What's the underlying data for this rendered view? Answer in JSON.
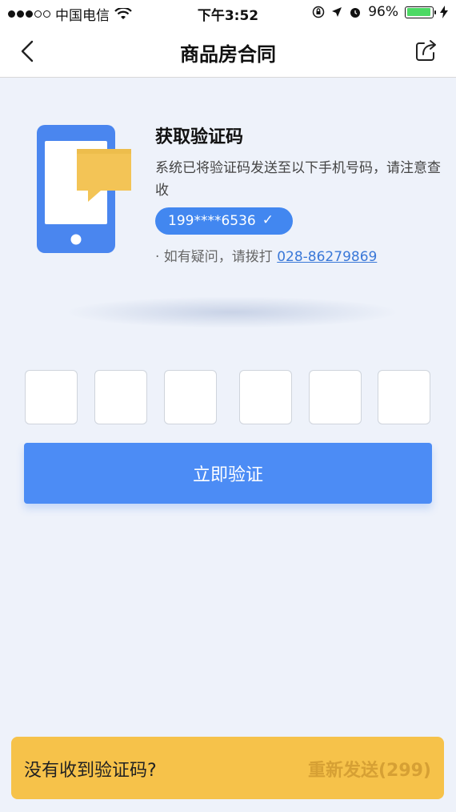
{
  "status_bar": {
    "carrier": "中国电信",
    "time": "下午3:52",
    "battery_percent": "96%",
    "battery_level": 0.96
  },
  "nav": {
    "title": "商品房合同"
  },
  "info": {
    "title": "获取验证码",
    "description": "系统已将验证码发送至以下手机号码，请注意查收",
    "phone": "199****6536",
    "help_prefix": "· 如有疑问，请拨打 ",
    "help_number": "028-86279869"
  },
  "code_inputs": [
    "",
    "",
    "",
    "",
    "",
    ""
  ],
  "verify_button": "立即验证",
  "resend": {
    "question": "没有收到验证码?",
    "button": "重新发送(299)"
  },
  "colors": {
    "accent": "#4c8cf5",
    "resend_bg": "#f6c24a",
    "bubble": "#f3c456"
  }
}
